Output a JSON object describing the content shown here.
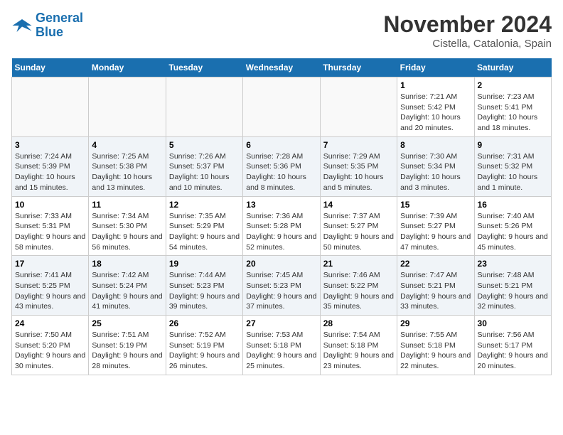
{
  "logo": {
    "line1": "General",
    "line2": "Blue"
  },
  "title": "November 2024",
  "location": "Cistella, Catalonia, Spain",
  "days_header": [
    "Sunday",
    "Monday",
    "Tuesday",
    "Wednesday",
    "Thursday",
    "Friday",
    "Saturday"
  ],
  "weeks": [
    [
      {
        "day": "",
        "empty": true
      },
      {
        "day": "",
        "empty": true
      },
      {
        "day": "",
        "empty": true
      },
      {
        "day": "",
        "empty": true
      },
      {
        "day": "",
        "empty": true
      },
      {
        "day": "1",
        "sunrise": "7:21 AM",
        "sunset": "5:42 PM",
        "daylight": "10 hours and 20 minutes."
      },
      {
        "day": "2",
        "sunrise": "7:23 AM",
        "sunset": "5:41 PM",
        "daylight": "10 hours and 18 minutes."
      }
    ],
    [
      {
        "day": "3",
        "sunrise": "7:24 AM",
        "sunset": "5:39 PM",
        "daylight": "10 hours and 15 minutes."
      },
      {
        "day": "4",
        "sunrise": "7:25 AM",
        "sunset": "5:38 PM",
        "daylight": "10 hours and 13 minutes."
      },
      {
        "day": "5",
        "sunrise": "7:26 AM",
        "sunset": "5:37 PM",
        "daylight": "10 hours and 10 minutes."
      },
      {
        "day": "6",
        "sunrise": "7:28 AM",
        "sunset": "5:36 PM",
        "daylight": "10 hours and 8 minutes."
      },
      {
        "day": "7",
        "sunrise": "7:29 AM",
        "sunset": "5:35 PM",
        "daylight": "10 hours and 5 minutes."
      },
      {
        "day": "8",
        "sunrise": "7:30 AM",
        "sunset": "5:34 PM",
        "daylight": "10 hours and 3 minutes."
      },
      {
        "day": "9",
        "sunrise": "7:31 AM",
        "sunset": "5:32 PM",
        "daylight": "10 hours and 1 minute."
      }
    ],
    [
      {
        "day": "10",
        "sunrise": "7:33 AM",
        "sunset": "5:31 PM",
        "daylight": "9 hours and 58 minutes."
      },
      {
        "day": "11",
        "sunrise": "7:34 AM",
        "sunset": "5:30 PM",
        "daylight": "9 hours and 56 minutes."
      },
      {
        "day": "12",
        "sunrise": "7:35 AM",
        "sunset": "5:29 PM",
        "daylight": "9 hours and 54 minutes."
      },
      {
        "day": "13",
        "sunrise": "7:36 AM",
        "sunset": "5:28 PM",
        "daylight": "9 hours and 52 minutes."
      },
      {
        "day": "14",
        "sunrise": "7:37 AM",
        "sunset": "5:27 PM",
        "daylight": "9 hours and 50 minutes."
      },
      {
        "day": "15",
        "sunrise": "7:39 AM",
        "sunset": "5:27 PM",
        "daylight": "9 hours and 47 minutes."
      },
      {
        "day": "16",
        "sunrise": "7:40 AM",
        "sunset": "5:26 PM",
        "daylight": "9 hours and 45 minutes."
      }
    ],
    [
      {
        "day": "17",
        "sunrise": "7:41 AM",
        "sunset": "5:25 PM",
        "daylight": "9 hours and 43 minutes."
      },
      {
        "day": "18",
        "sunrise": "7:42 AM",
        "sunset": "5:24 PM",
        "daylight": "9 hours and 41 minutes."
      },
      {
        "day": "19",
        "sunrise": "7:44 AM",
        "sunset": "5:23 PM",
        "daylight": "9 hours and 39 minutes."
      },
      {
        "day": "20",
        "sunrise": "7:45 AM",
        "sunset": "5:23 PM",
        "daylight": "9 hours and 37 minutes."
      },
      {
        "day": "21",
        "sunrise": "7:46 AM",
        "sunset": "5:22 PM",
        "daylight": "9 hours and 35 minutes."
      },
      {
        "day": "22",
        "sunrise": "7:47 AM",
        "sunset": "5:21 PM",
        "daylight": "9 hours and 33 minutes."
      },
      {
        "day": "23",
        "sunrise": "7:48 AM",
        "sunset": "5:21 PM",
        "daylight": "9 hours and 32 minutes."
      }
    ],
    [
      {
        "day": "24",
        "sunrise": "7:50 AM",
        "sunset": "5:20 PM",
        "daylight": "9 hours and 30 minutes."
      },
      {
        "day": "25",
        "sunrise": "7:51 AM",
        "sunset": "5:19 PM",
        "daylight": "9 hours and 28 minutes."
      },
      {
        "day": "26",
        "sunrise": "7:52 AM",
        "sunset": "5:19 PM",
        "daylight": "9 hours and 26 minutes."
      },
      {
        "day": "27",
        "sunrise": "7:53 AM",
        "sunset": "5:18 PM",
        "daylight": "9 hours and 25 minutes."
      },
      {
        "day": "28",
        "sunrise": "7:54 AM",
        "sunset": "5:18 PM",
        "daylight": "9 hours and 23 minutes."
      },
      {
        "day": "29",
        "sunrise": "7:55 AM",
        "sunset": "5:18 PM",
        "daylight": "9 hours and 22 minutes."
      },
      {
        "day": "30",
        "sunrise": "7:56 AM",
        "sunset": "5:17 PM",
        "daylight": "9 hours and 20 minutes."
      }
    ]
  ]
}
